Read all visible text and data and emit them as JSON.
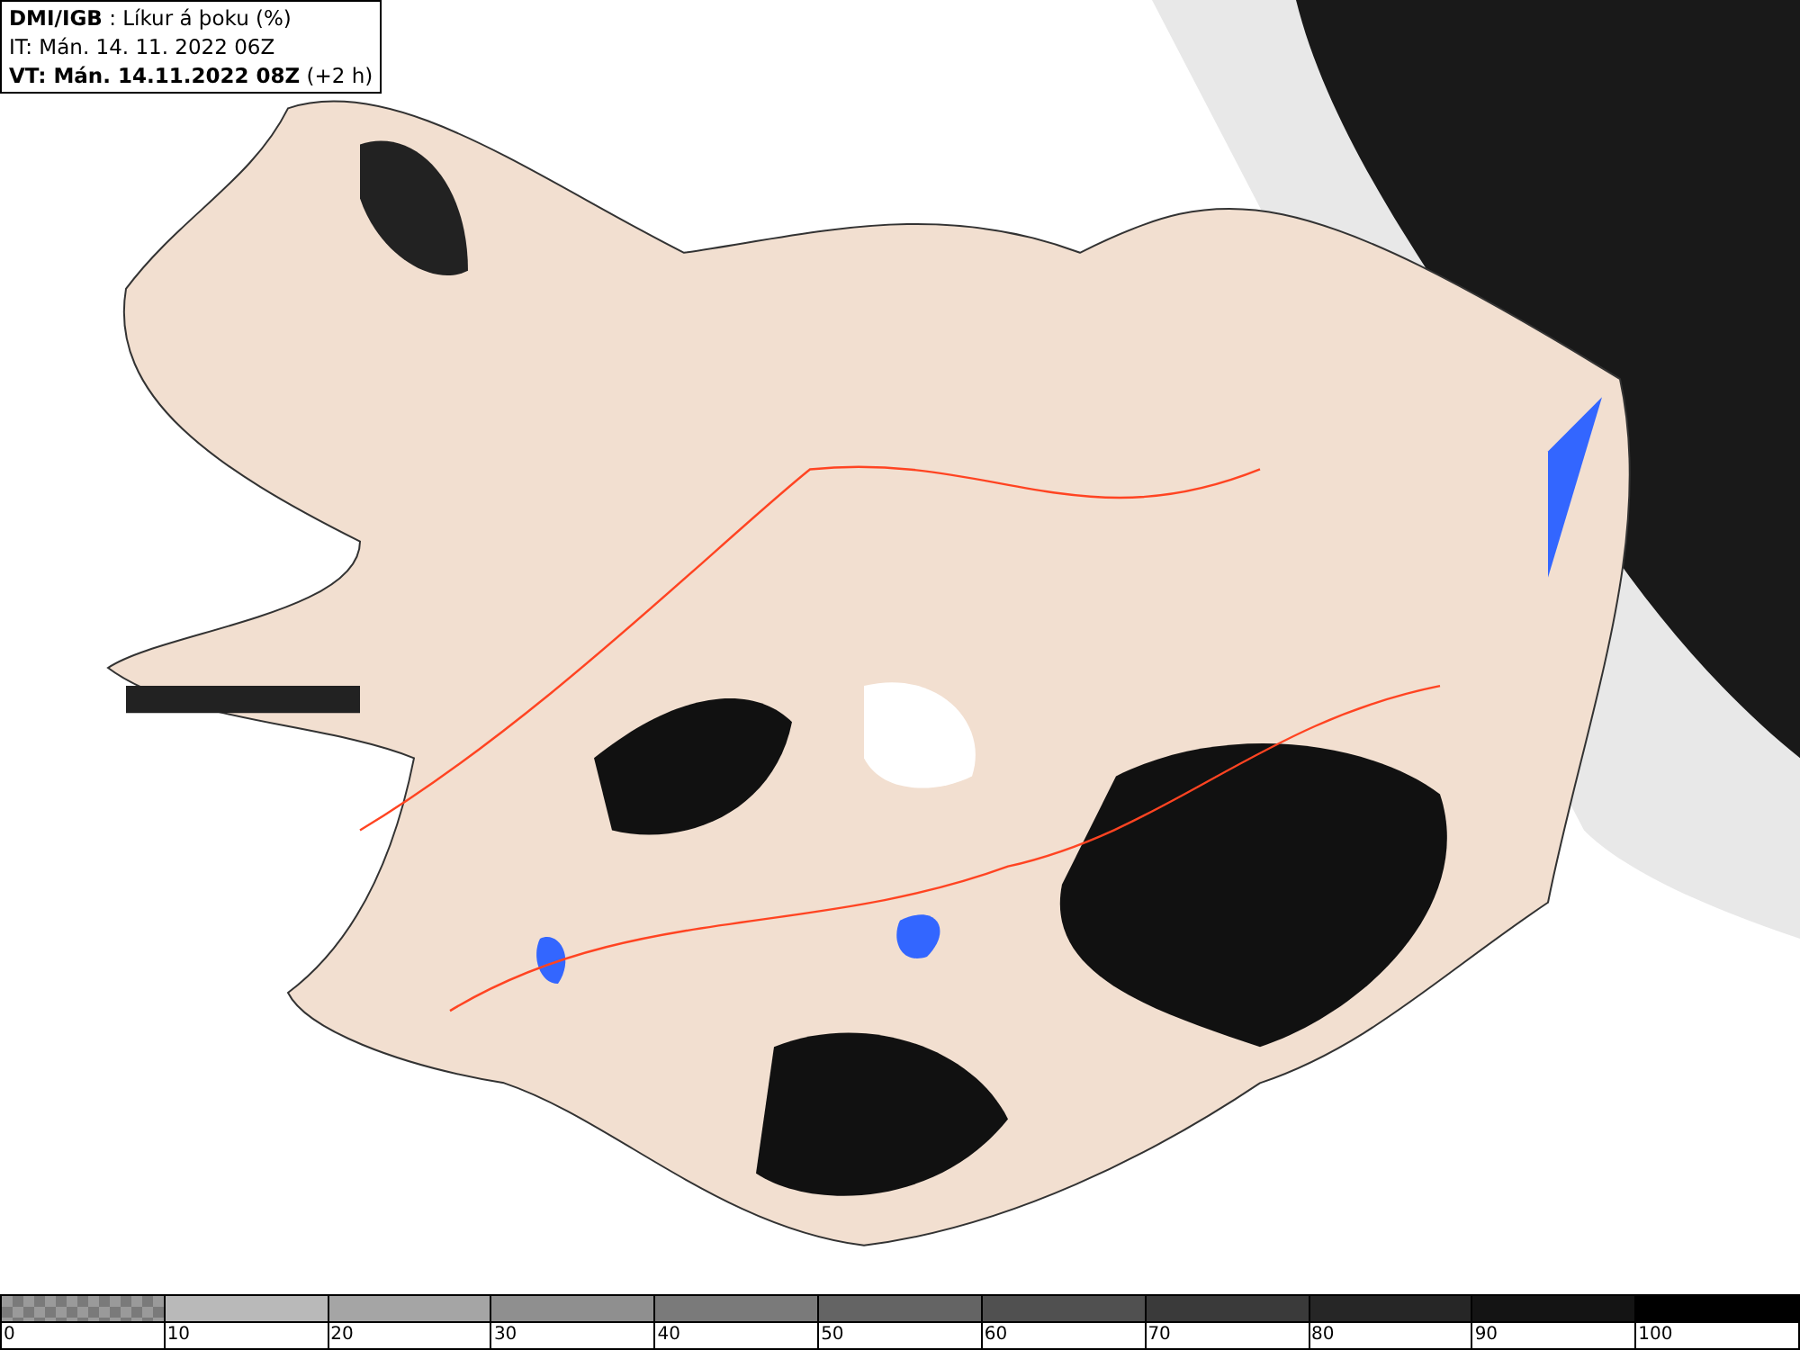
{
  "info_box": {
    "lines": [
      "**DMI/IGB** : Líkur á þoku (%)",
      "IT: Mán. 14. 11. 2022 06Z",
      "**VT: Mán. 14.11.2022 08Z** (+2 h)"
    ]
  },
  "legend": {
    "swatches": [
      {
        "kind": "checker",
        "color": "#7a7a7a",
        "label": "0"
      },
      {
        "kind": "solid",
        "color": "#b9b9b9",
        "label": "10"
      },
      {
        "kind": "solid",
        "color": "#a5a5a5",
        "label": "20"
      },
      {
        "kind": "solid",
        "color": "#8f8f8f",
        "label": "30"
      },
      {
        "kind": "solid",
        "color": "#7a7a7a",
        "label": "40"
      },
      {
        "kind": "solid",
        "color": "#646464",
        "label": "50"
      },
      {
        "kind": "solid",
        "color": "#505050",
        "label": "60"
      },
      {
        "kind": "solid",
        "color": "#3a3a3a",
        "label": "70"
      },
      {
        "kind": "solid",
        "color": "#262626",
        "label": "80"
      },
      {
        "kind": "solid",
        "color": "#141414",
        "label": "90"
      },
      {
        "kind": "solid",
        "color": "#000000",
        "label": "100"
      }
    ]
  }
}
